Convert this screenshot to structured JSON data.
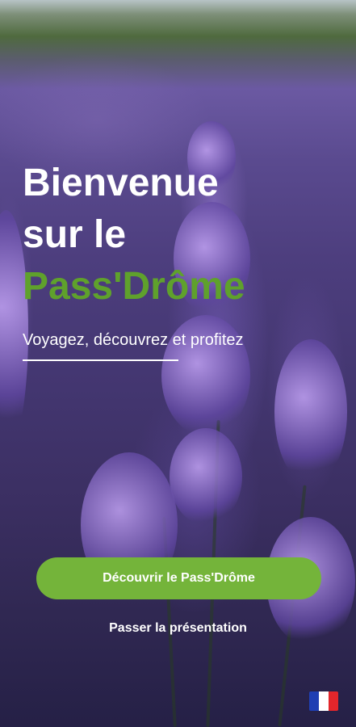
{
  "welcome": {
    "line1": "Bienvenue",
    "line2": "sur le",
    "brand": "Pass'Drôme",
    "tagline": "Voyagez, découvrez et profitez"
  },
  "actions": {
    "discover_label": "Découvrir le Pass'Drôme",
    "skip_label": "Passer la présentation"
  },
  "language": {
    "icon": "france-flag-icon"
  },
  "colors": {
    "brand_green": "#5fa12c",
    "button_green": "#74b43a",
    "text": "#ffffff",
    "flag_blue": "#1f3fb3",
    "flag_white": "#ffffff",
    "flag_red": "#e3262b"
  }
}
